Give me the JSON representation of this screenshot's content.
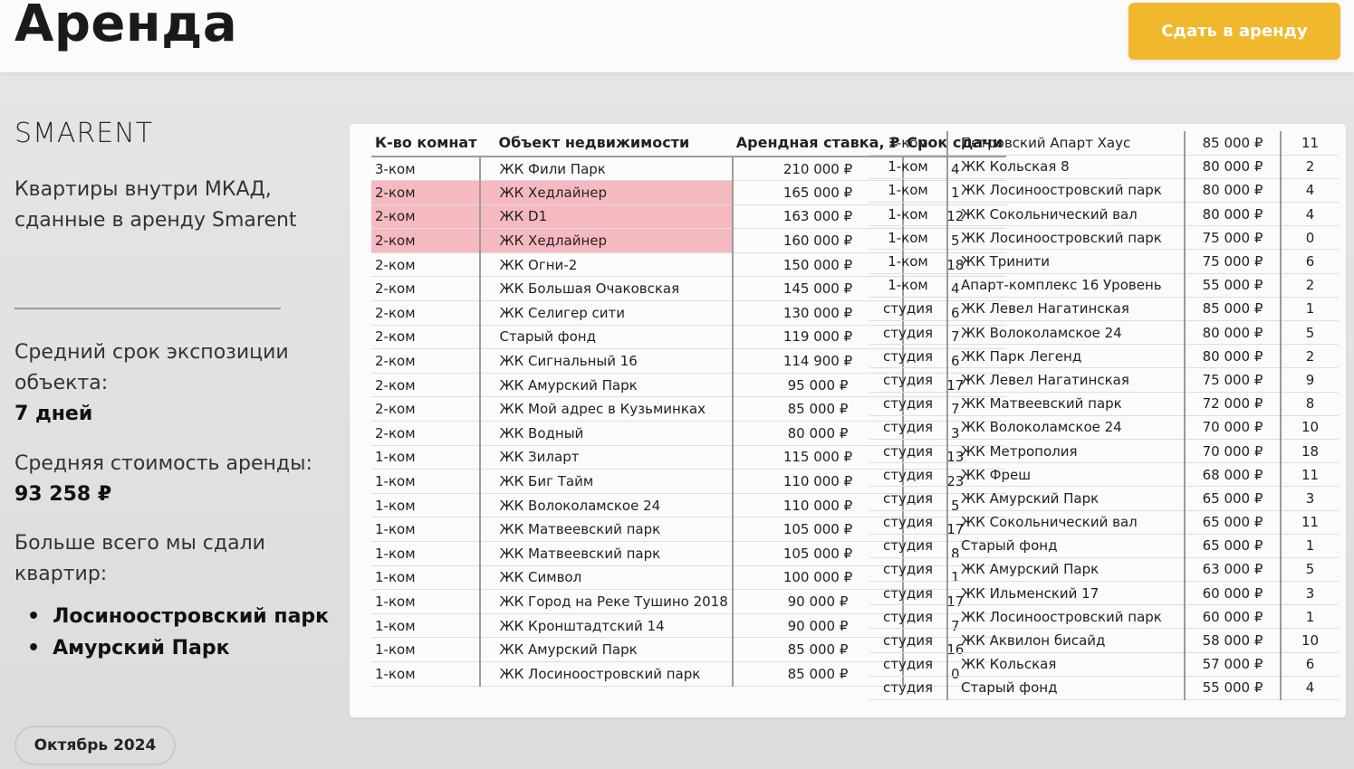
{
  "header": {
    "title": "Аренда",
    "cta_label": "Сдать в аренду",
    "cta_color": "#f1b82d"
  },
  "sidebar": {
    "brand": "SMARENT",
    "description": "Квартиры внутри МКАД, сданные в аренду Smarent",
    "exposure_label": "Средний срок экспозиции объекта:",
    "exposure_value": "7 дней",
    "avg_price_label": "Средняя стоимость аренды:",
    "avg_price_value": "93 258 ₽",
    "most_rented_label": "Больше всего мы сдали квартир:",
    "most_rented": [
      "Лосиноостровский парк",
      "Амурский Парк"
    ],
    "date_badge": "Октябрь 2024"
  },
  "table": {
    "headers": {
      "rooms": "К-во комнат",
      "object": "Объект недвижимости",
      "rate": "Арендная ставка, ₽",
      "term": "Срок сдачи"
    },
    "highlight_color": "#f7b9c0",
    "left_rows": [
      {
        "rooms": "3-ком",
        "object": "ЖК Фили Парк",
        "rate": "210 000 ₽",
        "term": "4",
        "highlight": false
      },
      {
        "rooms": "2-ком",
        "object": "ЖК Хедлайнер",
        "rate": "165 000 ₽",
        "term": "1",
        "highlight": true
      },
      {
        "rooms": "2-ком",
        "object": "ЖК D1",
        "rate": "163 000 ₽",
        "term": "12",
        "highlight": true
      },
      {
        "rooms": "2-ком",
        "object": "ЖК Хедлайнер",
        "rate": "160 000 ₽",
        "term": "5",
        "highlight": true
      },
      {
        "rooms": "2-ком",
        "object": "ЖК Огни-2",
        "rate": "150 000 ₽",
        "term": "18",
        "highlight": false
      },
      {
        "rooms": "2-ком",
        "object": "ЖК Большая Очаковская",
        "rate": "145 000 ₽",
        "term": "4",
        "highlight": false
      },
      {
        "rooms": "2-ком",
        "object": "ЖК Селигер сити",
        "rate": "130 000 ₽",
        "term": "6",
        "highlight": false
      },
      {
        "rooms": "2-ком",
        "object": "Старый фонд",
        "rate": "119 000 ₽",
        "term": "7",
        "highlight": false
      },
      {
        "rooms": "2-ком",
        "object": "ЖК Сигнальный 16",
        "rate": "114 900 ₽",
        "term": "6",
        "highlight": false
      },
      {
        "rooms": "2-ком",
        "object": "ЖК Амурский Парк",
        "rate": "95 000 ₽",
        "term": "17",
        "highlight": false
      },
      {
        "rooms": "2-ком",
        "object": "ЖК Мой адрес в Кузьминках",
        "rate": "85 000 ₽",
        "term": "7",
        "highlight": false
      },
      {
        "rooms": "2-ком",
        "object": "ЖК Водный",
        "rate": "80 000 ₽",
        "term": "3",
        "highlight": false
      },
      {
        "rooms": "1-ком",
        "object": "ЖК Зиларт",
        "rate": "115 000 ₽",
        "term": "13",
        "highlight": false
      },
      {
        "rooms": "1-ком",
        "object": "ЖК Биг Тайм",
        "rate": "110 000 ₽",
        "term": "23",
        "highlight": false
      },
      {
        "rooms": "1-ком",
        "object": "ЖК Волоколамское 24",
        "rate": "110 000 ₽",
        "term": "5",
        "highlight": false
      },
      {
        "rooms": "1-ком",
        "object": "ЖК Матвеевский парк",
        "rate": "105 000 ₽",
        "term": "17",
        "highlight": false
      },
      {
        "rooms": "1-ком",
        "object": "ЖК Матвеевский парк",
        "rate": "105 000 ₽",
        "term": "8",
        "highlight": false
      },
      {
        "rooms": "1-ком",
        "object": "ЖК Символ",
        "rate": "100 000 ₽",
        "term": "1",
        "highlight": false
      },
      {
        "rooms": "1-ком",
        "object": "ЖК Город на Реке Тушино 2018",
        "rate": "90 000 ₽",
        "term": "17",
        "highlight": false
      },
      {
        "rooms": "1-ком",
        "object": "ЖК Кронштадтский 14",
        "rate": "90 000 ₽",
        "term": "7",
        "highlight": false
      },
      {
        "rooms": "1-ком",
        "object": "ЖК Амурский Парк",
        "rate": "85 000 ₽",
        "term": "16",
        "highlight": false
      },
      {
        "rooms": "1-ком",
        "object": "ЖК Лосиноостровский парк",
        "rate": "85 000 ₽",
        "term": "0",
        "highlight": false
      }
    ],
    "right_rows": [
      {
        "rooms": "1-ком",
        "object": "Петровский Апарт Хаус",
        "rate": "85 000 ₽",
        "term": "11"
      },
      {
        "rooms": "1-ком",
        "object": "ЖК Кольская 8",
        "rate": "80 000 ₽",
        "term": "2"
      },
      {
        "rooms": "1-ком",
        "object": "ЖК Лосиноостровский парк",
        "rate": "80 000 ₽",
        "term": "4"
      },
      {
        "rooms": "1-ком",
        "object": "ЖК Сокольнический вал",
        "rate": "80 000 ₽",
        "term": "4"
      },
      {
        "rooms": "1-ком",
        "object": "ЖК Лосиноостровский парк",
        "rate": "75 000 ₽",
        "term": "0"
      },
      {
        "rooms": "1-ком",
        "object": "ЖК Тринити",
        "rate": "75 000 ₽",
        "term": "6"
      },
      {
        "rooms": "1-ком",
        "object": "Апарт-комплекс 16 Уровень",
        "rate": "55 000 ₽",
        "term": "2"
      },
      {
        "rooms": "студия",
        "object": "ЖК Левел Нагатинская",
        "rate": "85 000 ₽",
        "term": "1"
      },
      {
        "rooms": "студия",
        "object": "ЖК Волоколамское 24",
        "rate": "80 000 ₽",
        "term": "5"
      },
      {
        "rooms": "студия",
        "object": "ЖК Парк Легенд",
        "rate": "80 000 ₽",
        "term": "2"
      },
      {
        "rooms": "студия",
        "object": "ЖК Левел Нагатинская",
        "rate": "75 000 ₽",
        "term": "9"
      },
      {
        "rooms": "студия",
        "object": "ЖК Матвеевский парк",
        "rate": "72 000 ₽",
        "term": "8"
      },
      {
        "rooms": "студия",
        "object": "ЖК Волоколамское 24",
        "rate": "70 000 ₽",
        "term": "10"
      },
      {
        "rooms": "студия",
        "object": "ЖК Метрополия",
        "rate": "70 000 ₽",
        "term": "18"
      },
      {
        "rooms": "студия",
        "object": "ЖК Фреш",
        "rate": "68 000 ₽",
        "term": "11"
      },
      {
        "rooms": "студия",
        "object": "ЖК Амурский Парк",
        "rate": "65 000 ₽",
        "term": "3"
      },
      {
        "rooms": "студия",
        "object": "ЖК Сокольнический вал",
        "rate": "65 000 ₽",
        "term": "11"
      },
      {
        "rooms": "студия",
        "object": "Старый фонд",
        "rate": "65 000 ₽",
        "term": "1"
      },
      {
        "rooms": "студия",
        "object": "ЖК Амурский Парк",
        "rate": "63 000 ₽",
        "term": "5"
      },
      {
        "rooms": "студия",
        "object": "ЖК Ильменский 17",
        "rate": "60 000 ₽",
        "term": "3"
      },
      {
        "rooms": "студия",
        "object": "ЖК Лосиноостровский парк",
        "rate": "60 000 ₽",
        "term": "1"
      },
      {
        "rooms": "студия",
        "object": "ЖК Аквилон бисайд",
        "rate": "58 000 ₽",
        "term": "10"
      },
      {
        "rooms": "студия",
        "object": "ЖК Кольская",
        "rate": "57 000 ₽",
        "term": "6"
      },
      {
        "rooms": "студия",
        "object": "Старый фонд",
        "rate": "55 000 ₽",
        "term": "4"
      }
    ]
  }
}
